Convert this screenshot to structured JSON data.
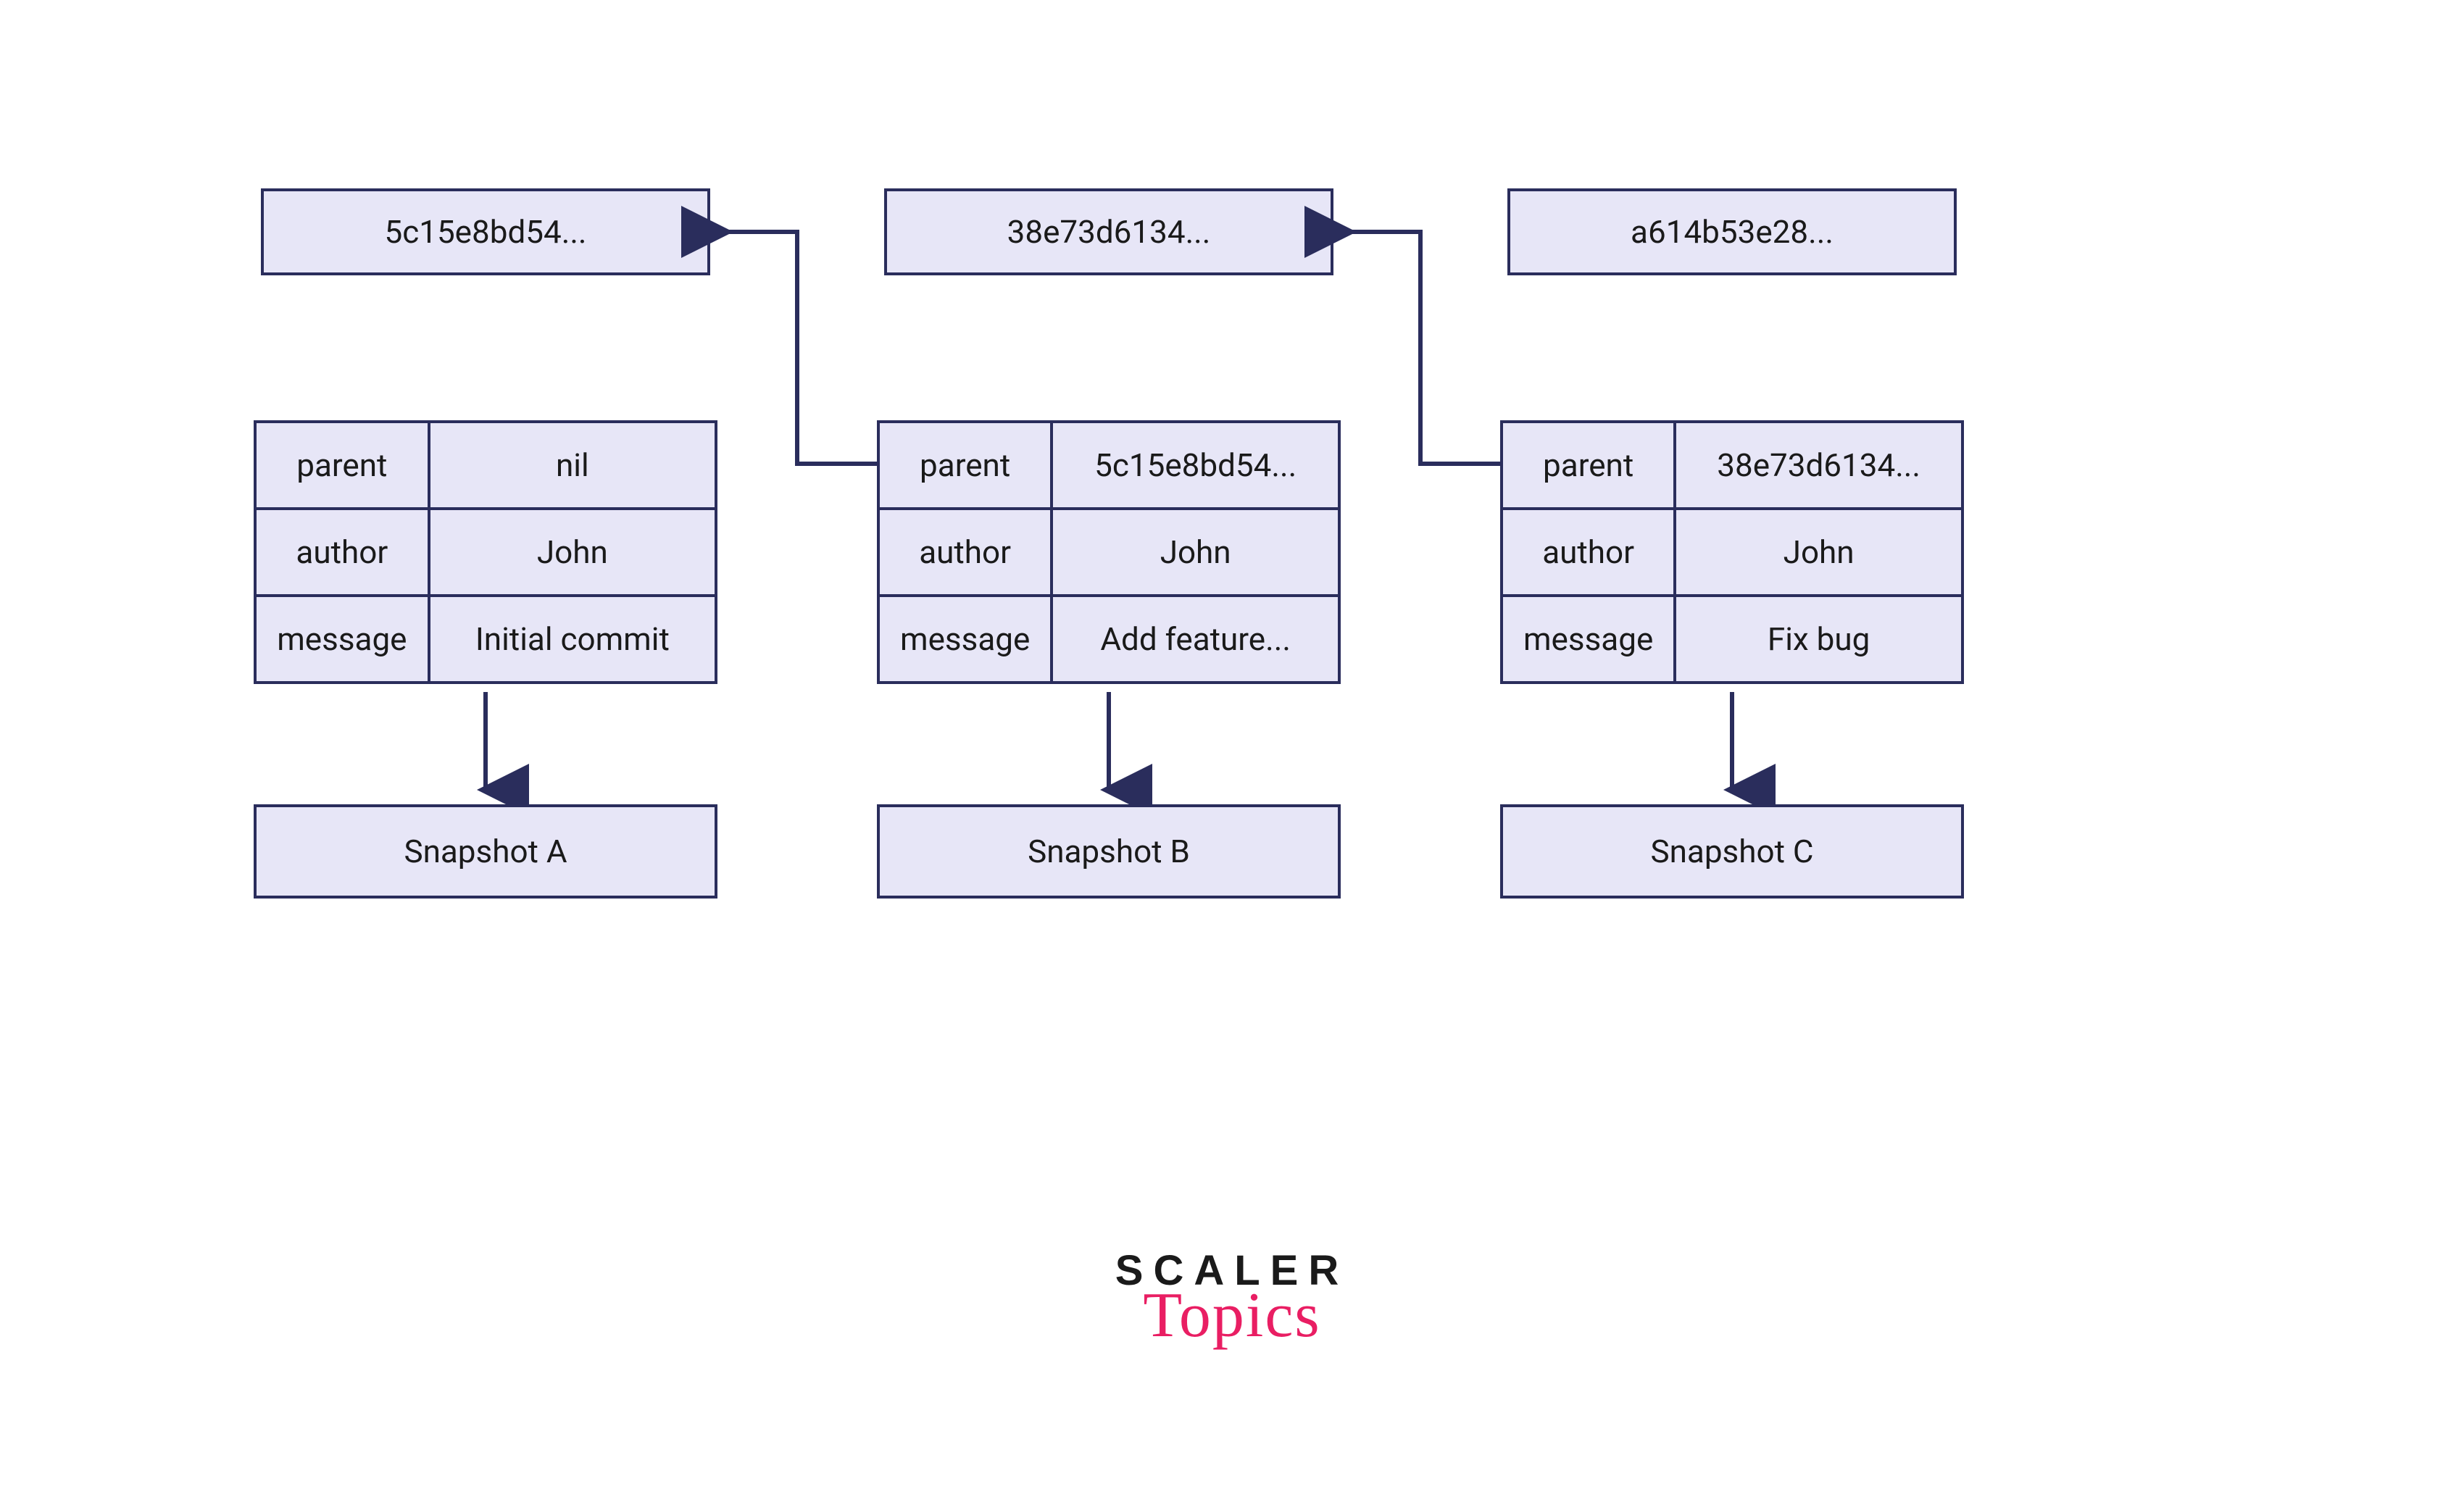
{
  "commits": [
    {
      "hash": "5c15e8bd54...",
      "fields": {
        "parent": "nil",
        "author": "John",
        "message": "Initial commit"
      },
      "snapshot": "Snapshot A"
    },
    {
      "hash": "38e73d6134...",
      "fields": {
        "parent": "5c15e8bd54...",
        "author": "John",
        "message": "Add feature..."
      },
      "snapshot": "Snapshot B"
    },
    {
      "hash": "a614b53e28...",
      "fields": {
        "parent": "38e73d6134...",
        "author": "John",
        "message": "Fix bug"
      },
      "snapshot": "Snapshot C"
    }
  ],
  "labels": {
    "parent": "parent",
    "author": "author",
    "message": "message"
  },
  "logo": {
    "line1": "SCALER",
    "line2": "Topics"
  },
  "colors": {
    "boxFill": "#e7e6f7",
    "boxStroke": "#2a2d5c",
    "accent": "#e91e63"
  }
}
